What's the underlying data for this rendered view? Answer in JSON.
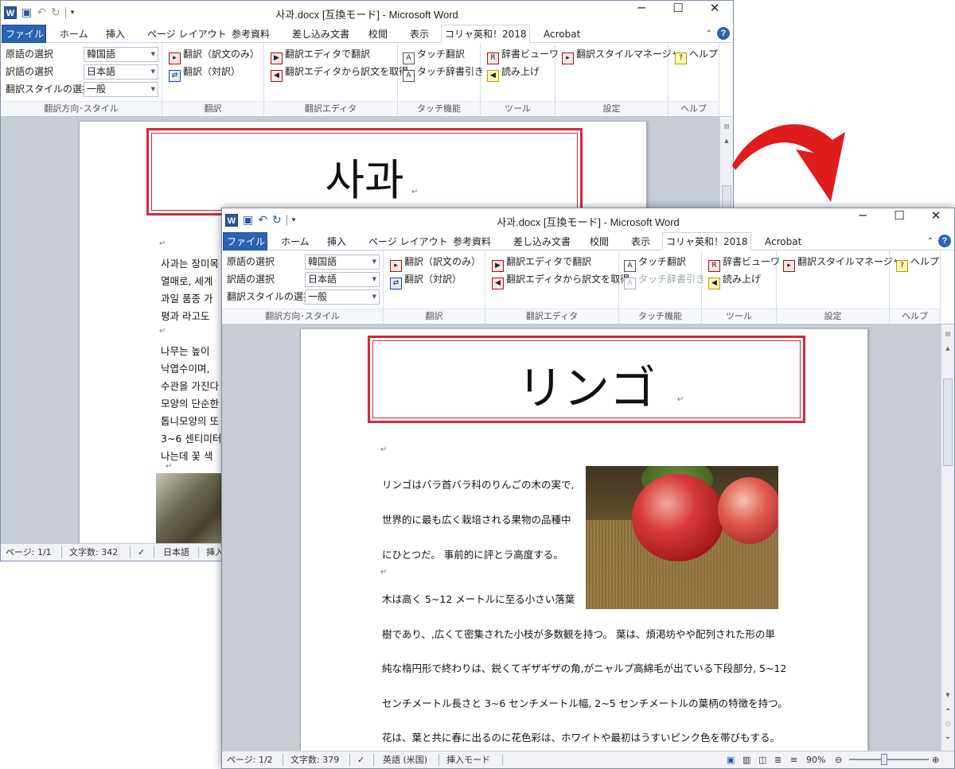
{
  "back_window": {
    "title": "사과.docx [互換モード] - Microsoft Word",
    "heading": "사과",
    "paragraph_lines": [
      "사과는 장미목",
      "열매로, 세계",
      "과일 품종 가",
      "평과 라고도"
    ],
    "paragraph2_lines": [
      "나무는 높이",
      "낙엽수이며,",
      "수관을 가진다",
      "모양의 단순한",
      "톱니모양의 또",
      "3~6 센티미터",
      "나는데 꽃 색"
    ],
    "status": {
      "page": "ページ: 1/1",
      "words": "文字数: 342",
      "language": "日本語",
      "mode": "挿入"
    }
  },
  "front_window": {
    "title": "사과.docx [互換モード] - Microsoft Word",
    "heading": "リンゴ",
    "paragraph1_lines": [
      "リンゴはバラ首バラ科のりんごの木の実で,",
      "世界的に最も広く栽培される果物の品種中",
      "にひとつだ。 事前的に評とラ高度する。"
    ],
    "paragraph2_lines": [
      "木は高く 5~12 メートルに至る小さい落葉",
      "樹であり、,広くて密集された小枝が多数観を持つ。 葉は、煩渇坊やや配列された形の単",
      "純な楕円形で終わりは、鋭くてギザギザの角,がニャルプ高綿毛が出ている下段部分, 5~12",
      "センチメートル長さと 3~6 センチメートル幅, 2~5 センチメートルの葉柄の特徴を持つ。",
      "花は、葉と共に春に出るのに花色彩は、ホワイトや最初はうすいピンク色を帯びもする。"
    ],
    "status": {
      "page": "ページ: 1/2",
      "words": "文字数: 379",
      "language": "英語 (米国)",
      "mode": "挿入モード",
      "zoom": "90%"
    }
  },
  "ribbon": {
    "tabs": [
      "ファイル",
      "ホーム",
      "挿入",
      "ページ レイアウト",
      "参考資料",
      "差し込み文書",
      "校閲",
      "表示",
      "コリャ英和！2018",
      "Acrobat"
    ],
    "source_label": "原語の選択",
    "source_value": "韓国語",
    "target_label": "訳語の選択",
    "target_value": "日本語",
    "style_label": "翻訳スタイルの選択",
    "style_value": "一般",
    "group_direction": "翻訳方向･スタイル",
    "translate_only": "翻訳（訳文のみ）",
    "translate_pair": "翻訳（対訳）",
    "group_translate": "翻訳",
    "editor_translate": "翻訳エディタで翻訳",
    "editor_get": "翻訳エディタから訳文を取得",
    "group_editor": "翻訳エディタ",
    "touch_translate": "タッチ翻訳",
    "touch_dict": "タッチ辞書引き",
    "group_touch": "タッチ機能",
    "dict_viewer": "辞書ビューワ",
    "read_aloud": "読み上げ",
    "group_tools": "ツール",
    "style_manager": "翻訳スタイルマネージャ",
    "group_settings": "設定",
    "help": "ヘルプ",
    "group_help": "ヘルプ"
  },
  "window_controls": {
    "minimize": "─",
    "maximize": "☐",
    "close": "✕"
  },
  "accent_red": "#d42a3a",
  "file_tab_color": "#2b62b3"
}
